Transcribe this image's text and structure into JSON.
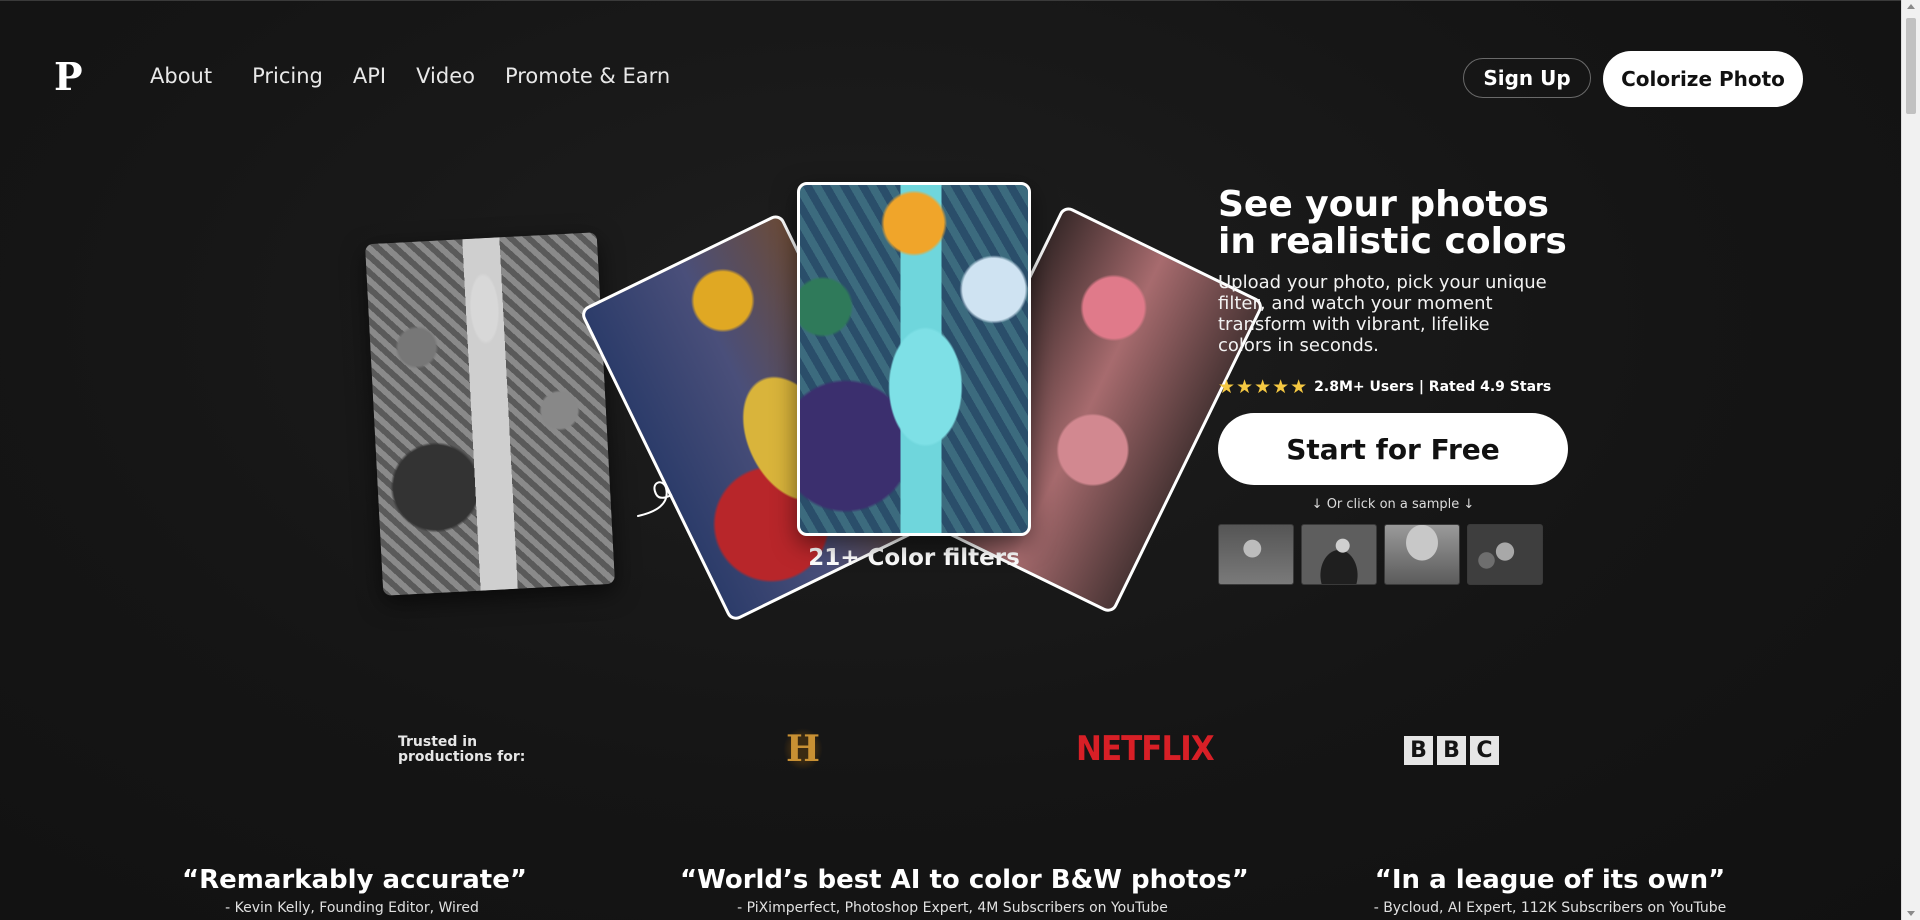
{
  "header": {
    "logo": "P",
    "nav": [
      "About",
      "Pricing",
      "API",
      "Video",
      "Promote & Earn"
    ],
    "sign_up": "Sign Up",
    "colorize_photo": "Colorize Photo"
  },
  "hero": {
    "filters_label": "21+ Color filters",
    "title": "See your photos in realistic colors",
    "subtitle": "Upload your photo, pick your unique filter, and watch your moment transform with vibrant, lifelike colors in seconds.",
    "stars": "★★★★★",
    "rating_text": "2.8M+ Users | Rated 4.9 Stars",
    "rating_value": 4.9,
    "start_button": "Start for Free",
    "sample_hint": "↓ Or click on a sample ↓"
  },
  "trusted": {
    "label": "Trusted in productions for:",
    "logos": {
      "history": "H",
      "netflix": "NETFLIX",
      "bbc": [
        "B",
        "B",
        "C"
      ]
    }
  },
  "testimonials": [
    {
      "quote": "“Remarkably accurate”",
      "author": "- Kevin Kelly, Founding Editor, Wired"
    },
    {
      "quote": "“World’s best AI to color B&W photos”",
      "author": "- PiXimperfect, Photoshop Expert, 4M Subscribers on YouTube"
    },
    {
      "quote": "“In a league of its own”",
      "author": "- Bycloud, AI Expert, 112K Subscribers on YouTube"
    }
  ],
  "colors": {
    "background": "#141414",
    "button_bg": "#ffffff",
    "star": "#f5c842",
    "netflix_red": "#d81f26",
    "history_gold": "#c89033"
  }
}
